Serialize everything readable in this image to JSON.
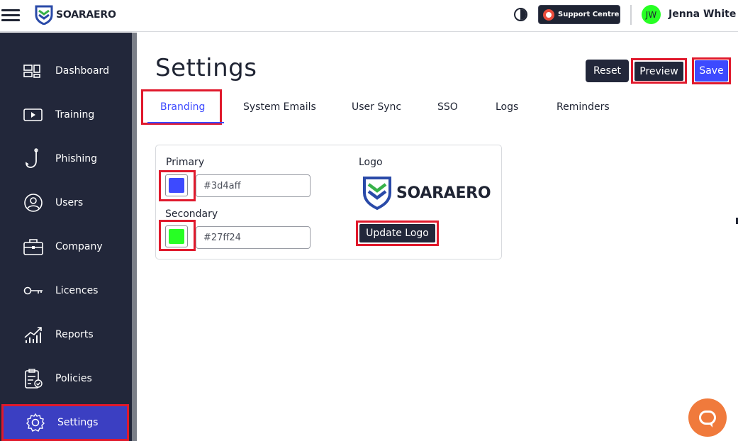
{
  "header": {
    "brand": "SOARAERO",
    "support_label": "Support Centre",
    "avatar_initials": "JW",
    "user_name": "Jenna White"
  },
  "sidebar": {
    "items": [
      {
        "label": "Dashboard",
        "icon": "dashboard-icon"
      },
      {
        "label": "Training",
        "icon": "video-icon"
      },
      {
        "label": "Phishing",
        "icon": "hook-icon"
      },
      {
        "label": "Users",
        "icon": "user-icon"
      },
      {
        "label": "Company",
        "icon": "briefcase-icon"
      },
      {
        "label": "Licences",
        "icon": "key-icon"
      },
      {
        "label": "Reports",
        "icon": "chart-icon"
      },
      {
        "label": "Policies",
        "icon": "clipboard-icon"
      },
      {
        "label": "Settings",
        "icon": "gear-icon",
        "active": true
      }
    ]
  },
  "main": {
    "title": "Settings",
    "buttons": {
      "reset": "Reset",
      "preview": "Preview",
      "save": "Save"
    },
    "tabs": [
      {
        "label": "Branding",
        "active": true
      },
      {
        "label": "System Emails"
      },
      {
        "label": "User Sync"
      },
      {
        "label": "SSO"
      },
      {
        "label": "Logs"
      },
      {
        "label": "Reminders"
      }
    ],
    "branding": {
      "primary_label": "Primary",
      "primary_value": "#3d4aff",
      "secondary_label": "Secondary",
      "secondary_value": "#27ff24",
      "logo_label": "Logo",
      "logo_text": "SOARAERO",
      "update_logo": "Update Logo"
    }
  },
  "colors": {
    "sidebar_bg": "#22273a",
    "accent": "#3d4aff",
    "primary": "#3d4aff",
    "secondary": "#27ff24",
    "highlight": "#e0192c",
    "chat": "#f07a3c"
  }
}
